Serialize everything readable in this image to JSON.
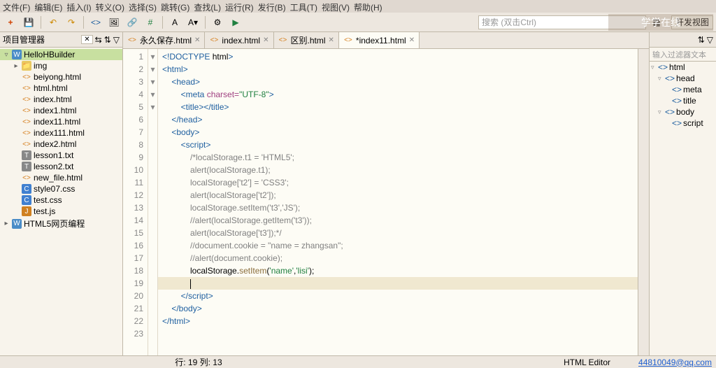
{
  "menu": [
    "文件(F)",
    "编辑(E)",
    "插入(I)",
    "转义(O)",
    "选择(S)",
    "跳转(G)",
    "查找(L)",
    "运行(R)",
    "发行(B)",
    "工具(T)",
    "视图(V)",
    "帮助(H)"
  ],
  "search_placeholder": "搜索 (双击Ctrl)",
  "perspective": "开发视图",
  "left": {
    "title": "项目管理器",
    "items": [
      {
        "ind": 0,
        "tw": "▿",
        "ic": "W",
        "cls": "ic-w",
        "label": "HelloHBuilder",
        "sel": true
      },
      {
        "ind": 1,
        "tw": "▸",
        "ic": "📁",
        "cls": "ic-f",
        "label": "img"
      },
      {
        "ind": 1,
        "tw": "",
        "ic": "<>",
        "cls": "ic-h",
        "label": "beiyong.html"
      },
      {
        "ind": 1,
        "tw": "",
        "ic": "<>",
        "cls": "ic-h",
        "label": "html.html"
      },
      {
        "ind": 1,
        "tw": "",
        "ic": "<>",
        "cls": "ic-h",
        "label": "index.html"
      },
      {
        "ind": 1,
        "tw": "",
        "ic": "<>",
        "cls": "ic-h",
        "label": "index1.html"
      },
      {
        "ind": 1,
        "tw": "",
        "ic": "<>",
        "cls": "ic-h",
        "label": "index11.html"
      },
      {
        "ind": 1,
        "tw": "",
        "ic": "<>",
        "cls": "ic-h",
        "label": "index111.html"
      },
      {
        "ind": 1,
        "tw": "",
        "ic": "<>",
        "cls": "ic-h",
        "label": "index2.html"
      },
      {
        "ind": 1,
        "tw": "",
        "ic": "T",
        "cls": "ic-t",
        "label": "lesson1.txt"
      },
      {
        "ind": 1,
        "tw": "",
        "ic": "T",
        "cls": "ic-t",
        "label": "lesson2.txt"
      },
      {
        "ind": 1,
        "tw": "",
        "ic": "<>",
        "cls": "ic-h",
        "label": "new_file.html"
      },
      {
        "ind": 1,
        "tw": "",
        "ic": "C",
        "cls": "ic-c",
        "label": "style07.css"
      },
      {
        "ind": 1,
        "tw": "",
        "ic": "C",
        "cls": "ic-c",
        "label": "test.css"
      },
      {
        "ind": 1,
        "tw": "",
        "ic": "J",
        "cls": "ic-j",
        "label": "test.js"
      },
      {
        "ind": 0,
        "tw": "▸",
        "ic": "W",
        "cls": "ic-w",
        "label": "HTML5网页编程"
      }
    ]
  },
  "tabs": [
    {
      "label": "永久保存.html",
      "act": false
    },
    {
      "label": "index.html",
      "act": false
    },
    {
      "label": "区别.html",
      "act": false
    },
    {
      "label": "*index11.html",
      "act": true
    }
  ],
  "code": {
    "lines": 23,
    "folds": [
      "",
      "▾",
      "▾",
      "",
      "",
      "",
      "▾",
      "▾",
      "▾",
      "",
      "",
      "",
      "",
      "",
      "",
      "",
      "",
      "",
      "",
      "",
      "",
      "",
      ""
    ],
    "hl_row": 19,
    "content": [
      [
        [
          "t-tag",
          "<!DOCTYPE "
        ],
        [
          "",
          "html"
        ],
        [
          "t-tag",
          ">"
        ]
      ],
      [
        [
          "t-tag",
          "<html>"
        ]
      ],
      [
        [
          "",
          "    "
        ],
        [
          "t-tag",
          "<head>"
        ]
      ],
      [
        [
          "",
          "        "
        ],
        [
          "t-tag",
          "<meta "
        ],
        [
          "t-kw",
          "charset="
        ],
        [
          "t-str",
          "\"UTF-8\""
        ],
        [
          "t-tag",
          ">"
        ]
      ],
      [
        [
          "",
          "        "
        ],
        [
          "t-tag",
          "<title></title>"
        ]
      ],
      [
        [
          "",
          "    "
        ],
        [
          "t-tag",
          "</head>"
        ]
      ],
      [
        [
          "",
          "    "
        ],
        [
          "t-tag",
          "<body>"
        ]
      ],
      [
        [
          "",
          "        "
        ],
        [
          "t-tag",
          "<script>"
        ]
      ],
      [
        [
          "",
          "            "
        ],
        [
          "t-cm",
          "/*localStorage.t1 = 'HTML5';"
        ]
      ],
      [
        [
          "",
          "            "
        ],
        [
          "t-cm",
          "alert(localStorage.t1);"
        ]
      ],
      [
        [
          "",
          "            "
        ],
        [
          "t-cm",
          "localStorage['t2'] = 'CSS3';"
        ]
      ],
      [
        [
          "",
          "            "
        ],
        [
          "t-cm",
          "alert(localStorage['t2']);"
        ]
      ],
      [
        [
          "",
          "            "
        ],
        [
          "t-cm",
          "localStorage.setItem('t3','JS');"
        ]
      ],
      [
        [
          "",
          "            "
        ],
        [
          "t-cm",
          "//alert(localStorage.getItem('t3'));"
        ]
      ],
      [
        [
          "",
          "            "
        ],
        [
          "t-cm",
          "alert(localStorage['t3']);*/"
        ]
      ],
      [
        [
          "",
          "            "
        ],
        [
          "t-cm",
          "//document.cookie = \"name = zhangsan\";"
        ]
      ],
      [
        [
          "",
          "            "
        ],
        [
          "t-cm",
          "//alert(document.cookie);"
        ]
      ],
      [
        [
          "",
          "            "
        ],
        [
          "",
          "localStorage."
        ],
        [
          "t-fn",
          "setItem"
        ],
        [
          "",
          "("
        ],
        [
          "t-str",
          "'name'"
        ],
        [
          "",
          ","
        ],
        [
          "t-str",
          "'lisi'"
        ],
        [
          "",
          ");"
        ]
      ],
      [
        [
          "",
          "            "
        ]
      ],
      [
        [
          "",
          "        "
        ],
        [
          "t-tag",
          "</"
        ],
        [
          "t-tag",
          "script"
        ],
        [
          "t-tag",
          ">"
        ]
      ],
      [
        [
          "",
          "    "
        ],
        [
          "t-tag",
          "</body>"
        ]
      ],
      [
        [
          "t-tag",
          "</html>"
        ]
      ],
      [
        [
          "",
          ""
        ]
      ]
    ]
  },
  "right": {
    "filter": "输入过滤器文本",
    "items": [
      {
        "ind": 0,
        "tw": "▿",
        "label": "html"
      },
      {
        "ind": 1,
        "tw": "▿",
        "label": "head"
      },
      {
        "ind": 2,
        "tw": "",
        "label": "meta"
      },
      {
        "ind": 2,
        "tw": "",
        "label": "title"
      },
      {
        "ind": 1,
        "tw": "▿",
        "label": "body"
      },
      {
        "ind": 2,
        "tw": "",
        "label": "script"
      }
    ]
  },
  "status": {
    "pos": "行: 19 列: 13",
    "mode": "HTML Editor",
    "email": "44810049@qq.com"
  },
  "watermark": "学学在线"
}
